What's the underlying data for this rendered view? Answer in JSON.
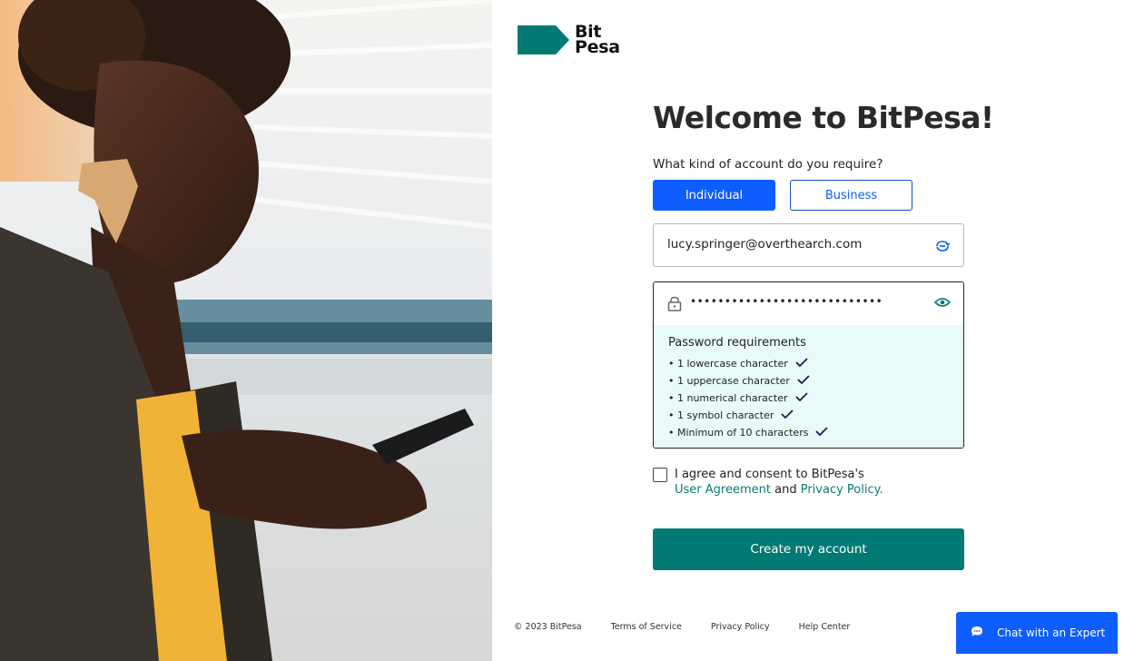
{
  "brand": {
    "logo_line1": "Bit",
    "logo_line2": "Pesa",
    "color": "#027a74"
  },
  "form": {
    "title": "Welcome to BitPesa!",
    "account_question": "What kind of account do you require?",
    "account_types": [
      {
        "label": "Individual",
        "selected": true
      },
      {
        "label": "Business",
        "selected": false
      }
    ],
    "email": {
      "value": "lucy.springer@overthearch.com",
      "icon": "autofill-icon"
    },
    "password": {
      "value": "••••••••••••••••••••••••••••",
      "lock_icon": "lock-icon",
      "toggle_icon": "eye-icon"
    },
    "requirements": {
      "title": "Password requirements",
      "items": [
        "• 1 lowercase character",
        "• 1 uppercase character",
        "• 1 numerical character",
        "• 1 symbol character",
        "• Minimum of 10 characters"
      ]
    },
    "agreement": {
      "text_prefix": "I agree and consent to BitPesa's",
      "link_user": "User Agreement",
      "and": "and",
      "link_privacy": "Privacy Policy.",
      "checked": false
    },
    "submit_label": "Create my account"
  },
  "footer": {
    "copyright": "© 2023 BitPesa",
    "links": [
      "Terms of Service",
      "Privacy Policy",
      "Help Center"
    ]
  },
  "chat": {
    "label": "Chat with an Expert"
  },
  "colors": {
    "primary_blue": "#0d5dff",
    "teal": "#027a74",
    "requirements_bg": "#e8fbf8"
  }
}
